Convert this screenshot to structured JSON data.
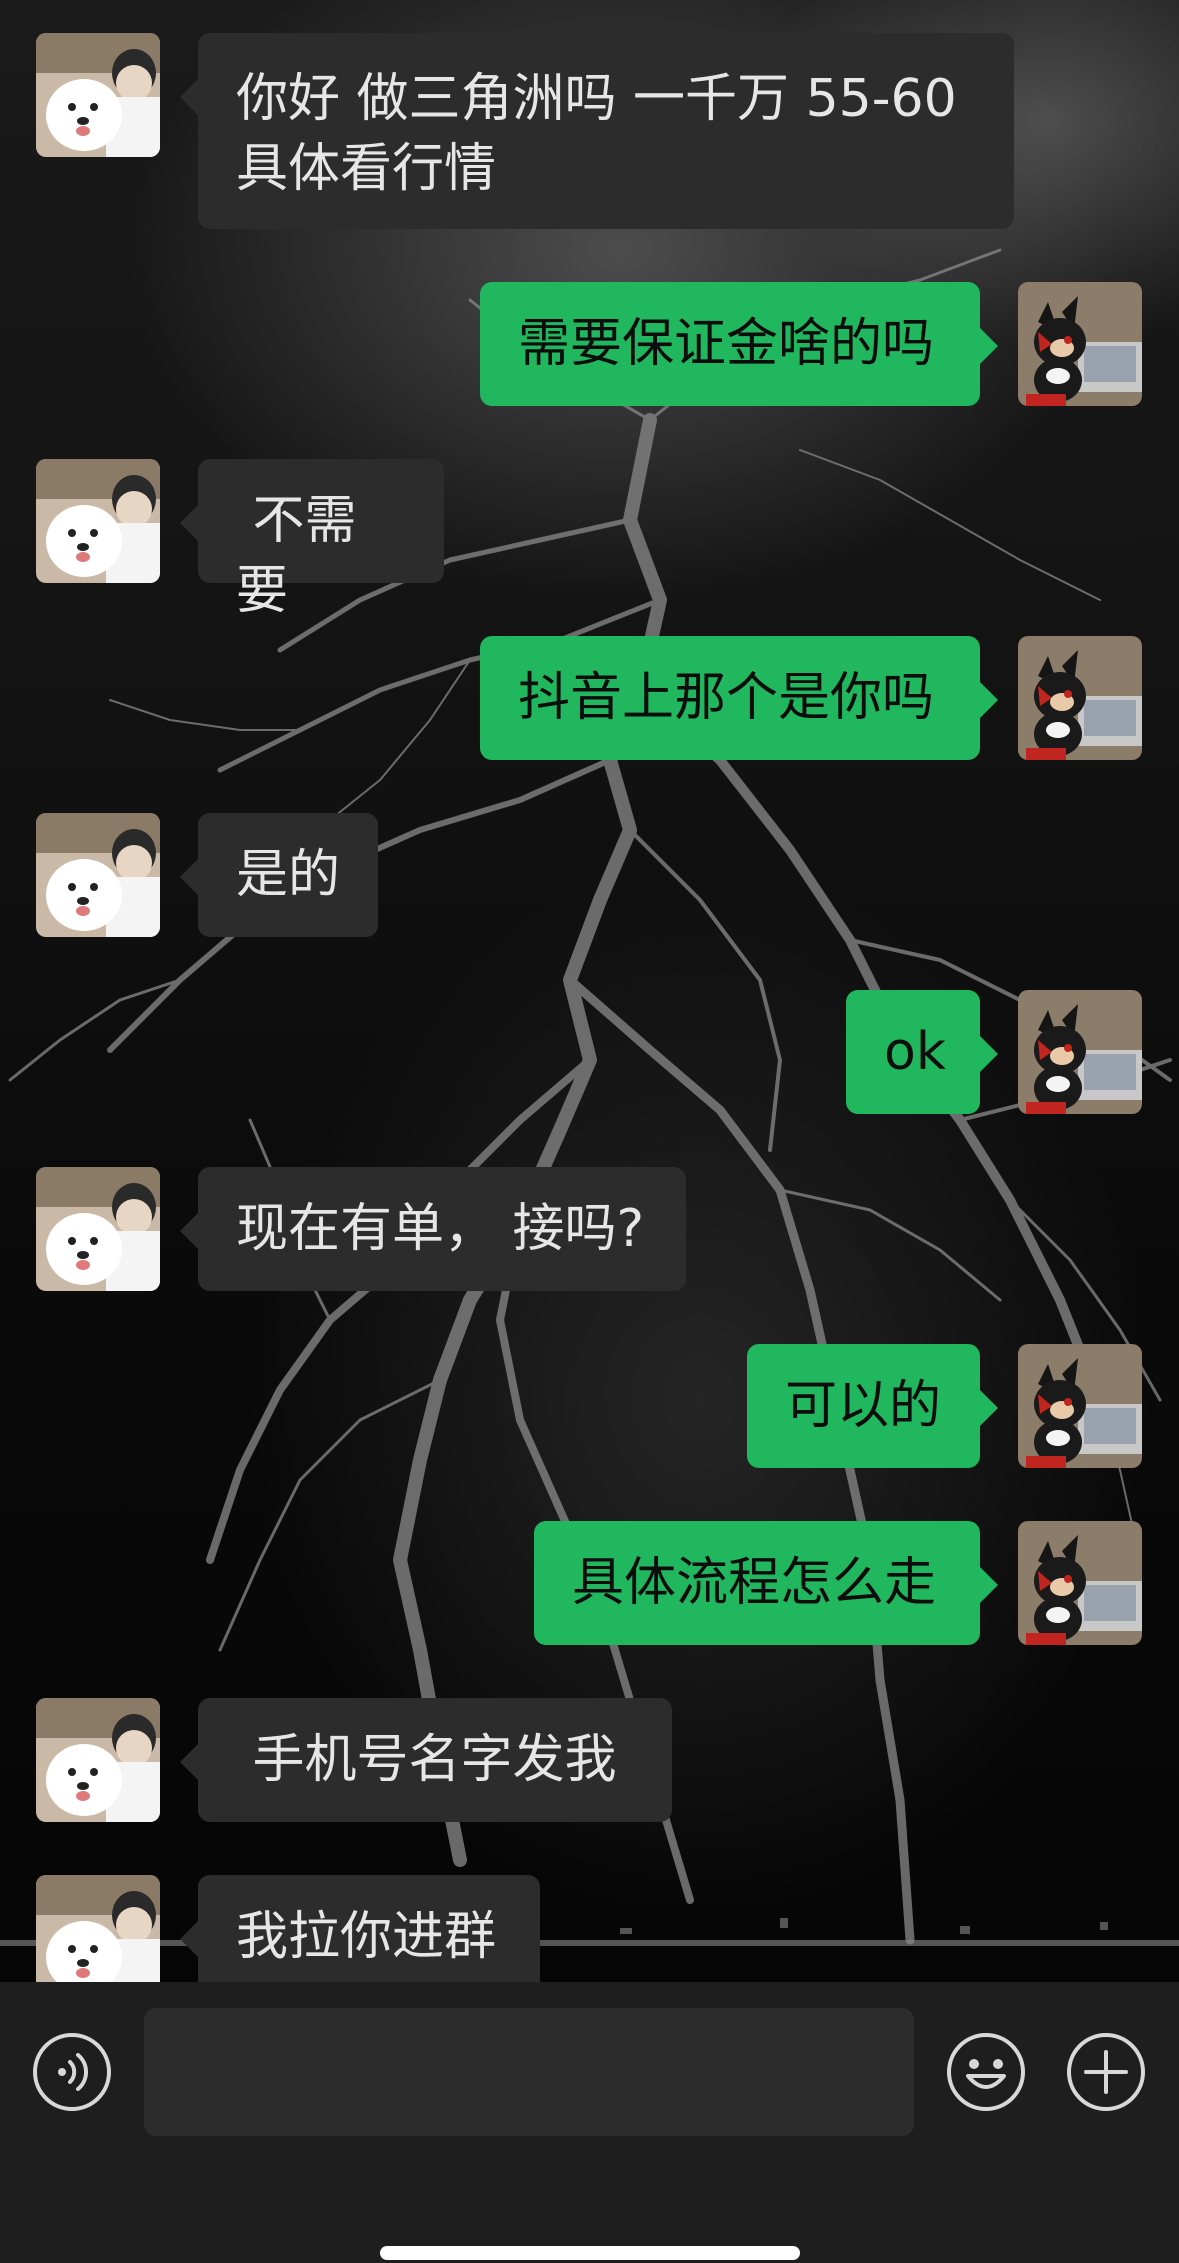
{
  "messages": [
    {
      "side": "in",
      "text": "你好 做三角洲吗 一千万 55-60\n具体看行情"
    },
    {
      "side": "out",
      "text": "需要保证金啥的吗"
    },
    {
      "side": "in",
      "text": " 不需要"
    },
    {
      "side": "out",
      "text": "抖音上那个是你吗"
    },
    {
      "side": "in",
      "text": "是的"
    },
    {
      "side": "out",
      "text": "ok"
    },
    {
      "side": "in",
      "text": "现在有单， 接吗?"
    },
    {
      "side": "out",
      "text": "可以的"
    },
    {
      "side": "out",
      "text": "具体流程怎么走"
    },
    {
      "side": "in",
      "text": " 手机号名字发我"
    },
    {
      "side": "in",
      "text": "我拉你进群"
    }
  ],
  "input": {
    "value": "",
    "placeholder": ""
  },
  "icons": {
    "voice": "voice-wave-icon",
    "emoji": "smiley-face-icon",
    "plus": "plus-circle-icon"
  },
  "colors": {
    "outgoing_bubble": "#21b75e",
    "incoming_bubble": "#2c2c2c",
    "bottom_bar": "#1e1e1e"
  }
}
